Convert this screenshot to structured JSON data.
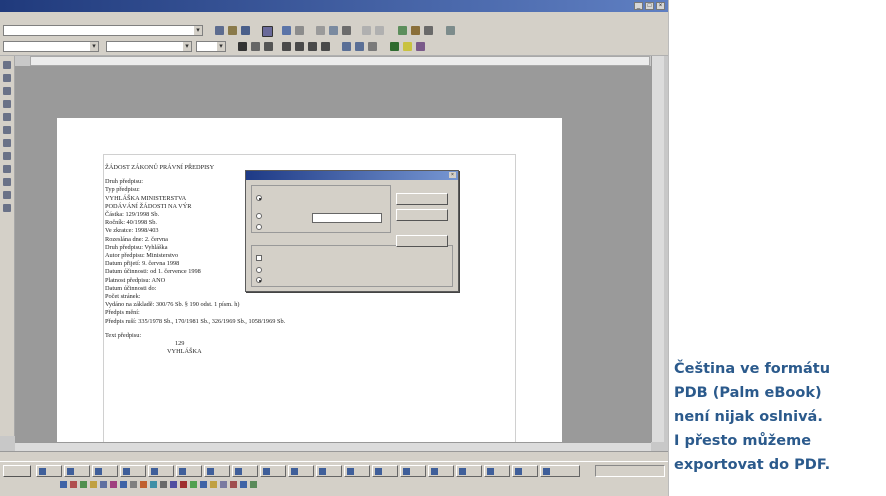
{
  "caption": {
    "lines": [
      "Čeština ve formátu",
      "PDB (Palm eBook)",
      "není nijak oslnivá.",
      "I přesto můžeme",
      "exportovat do PDF."
    ]
  },
  "document": {
    "lines": [
      "ŽÁDOST ZÁKONŮ PRÁVNÍ PŘEDPISY",
      "",
      "Druh předpisu:",
      "Typ předpisu:",
      "VYHLÁŠKA MINISTERSTVA",
      "PODÁVÁNÍ ŽÁDOSTI NA VÝR",
      "Částka: 129/1998 Sb.",
      "Ročník: 40/1998 Sb.",
      "Ve zkratce: 1998/403",
      "Rozeslána dne: 2. června",
      "Druh předpisu: Vyhláška",
      "Autor předpisu: Ministerstvo",
      "Datum přijetí: 9. června 1998",
      "Datum účinnosti: od 1. července 1998",
      "Platnost předpisu: ANO",
      "Datum účinnosti do:",
      "Počet stránek:",
      "Vydáno na základě: 300/76 Sb. § 190 odst. 1 písm. h)",
      "Předpis mění:",
      "Předpis ruší: 335/1978 Sb., 170/1981 Sb., 326/1969 Sb., 1058/1969 Sb.",
      "",
      "Text předpisu:",
      "129",
      "VYHLÁŠKA"
    ]
  }
}
